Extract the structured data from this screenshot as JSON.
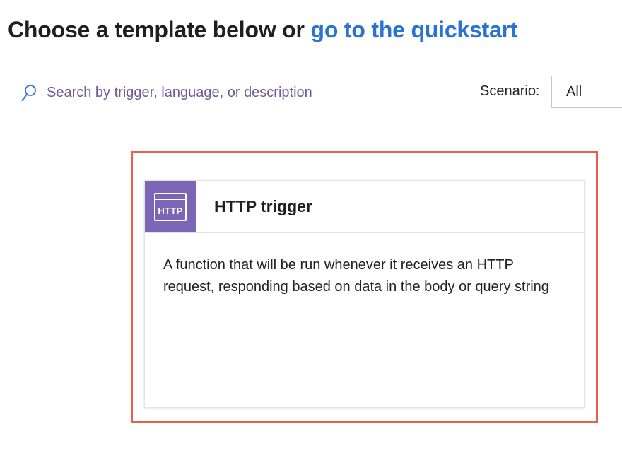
{
  "header": {
    "prefix": "Choose a template below or",
    "link": "go to the quickstart"
  },
  "search": {
    "placeholder": "Search by trigger, language, or description",
    "icon": "search-icon",
    "value": ""
  },
  "scenario": {
    "label": "Scenario:",
    "selected": "All"
  },
  "templates": [
    {
      "icon": "http-icon",
      "icon_text": "HTTP",
      "title": "HTTP trigger",
      "description": "A function that will be run whenever it receives an HTTP request, responding based on data in the body or query string"
    }
  ],
  "colors": {
    "link": "#2b73d2",
    "placeholder": "#6b5b95",
    "icon_bg": "#7b65b6",
    "highlight": "#e8604c"
  }
}
